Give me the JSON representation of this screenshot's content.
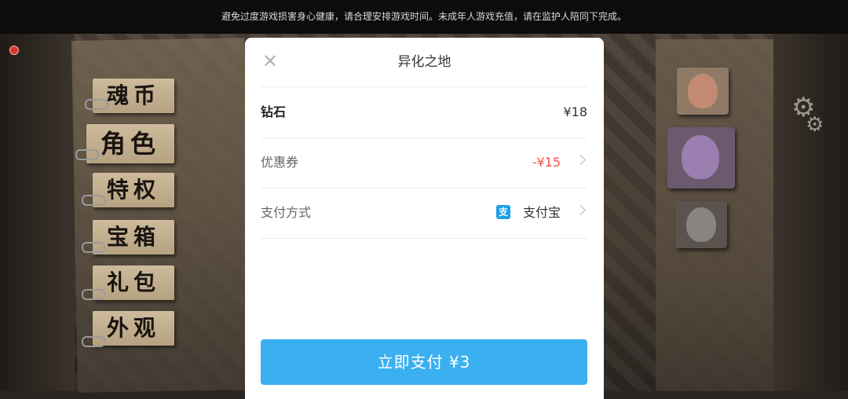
{
  "notice": {
    "text": "避免过度游戏损害身心健康，请合理安排游戏时间。未成年人游戏充值，请在监护人陪同下完成。"
  },
  "game_menu": {
    "items": [
      "魂币",
      "角色",
      "特权",
      "宝箱",
      "礼包",
      "外观"
    ]
  },
  "payment_sheet": {
    "title": "异化之地",
    "close_icon": "close-icon",
    "product": {
      "label": "钻石",
      "price": "¥18"
    },
    "coupon": {
      "label": "优惠券",
      "value": "-¥15",
      "value_color": "#f0524b"
    },
    "payment_method": {
      "label": "支付方式",
      "icon": "alipay-icon",
      "icon_glyph": "支",
      "value": "支付宝"
    },
    "pay_button": {
      "label": "立即支付 ¥3",
      "color": "#3ab0f0"
    }
  }
}
